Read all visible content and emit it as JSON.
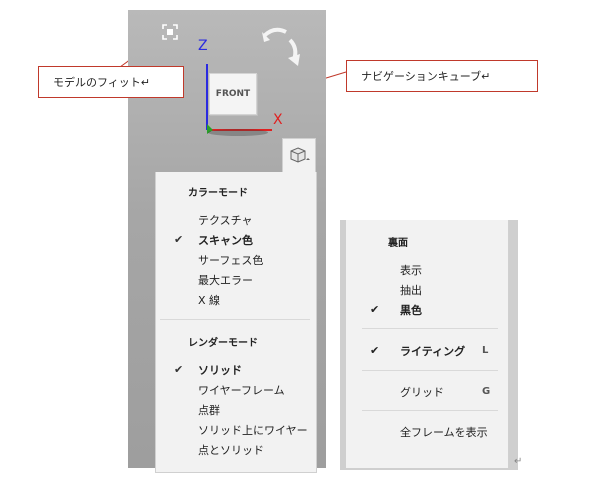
{
  "callouts": {
    "fit_model": "モデルのフィット↵",
    "nav_cube": "ナビゲーションキューブ↵"
  },
  "viewport": {
    "cube_face_label": "FRONT",
    "axis_z": "Z",
    "axis_x": "X",
    "colors": {
      "axis_z": "#2a2ae0",
      "axis_x": "#e02020",
      "callout_border": "#c0392b"
    }
  },
  "color_menu": {
    "title": "カラーモード",
    "items": [
      {
        "label": "テクスチャ",
        "checked": false,
        "bold": false
      },
      {
        "label": "スキャン色",
        "checked": true,
        "bold": true
      },
      {
        "label": "サーフェス色",
        "checked": false,
        "bold": false
      },
      {
        "label": "最大エラー",
        "checked": false,
        "bold": false
      },
      {
        "label": "X 線",
        "checked": false,
        "bold": false
      }
    ]
  },
  "render_menu": {
    "title": "レンダーモード",
    "items": [
      {
        "label": "ソリッド",
        "checked": true,
        "bold": true
      },
      {
        "label": "ワイヤーフレーム",
        "checked": false,
        "bold": false
      },
      {
        "label": "点群",
        "checked": false,
        "bold": false
      },
      {
        "label": "ソリッド上にワイヤー",
        "checked": false,
        "bold": false
      },
      {
        "label": "点とソリッド",
        "checked": false,
        "bold": false
      }
    ]
  },
  "right_menu": {
    "title": "裏面",
    "items": [
      {
        "label": "表示",
        "checked": false,
        "bold": false
      },
      {
        "label": "抽出",
        "checked": false,
        "bold": false
      },
      {
        "label": "黒色",
        "checked": true,
        "bold": true
      }
    ],
    "lighting": {
      "label": "ライティング",
      "shortcut": "L",
      "checked": true
    },
    "grid": {
      "label": "グリッド",
      "shortcut": "G"
    },
    "show_all": {
      "label": "全フレームを表示"
    }
  },
  "para_mark": "↵",
  "check_glyph": "✔"
}
